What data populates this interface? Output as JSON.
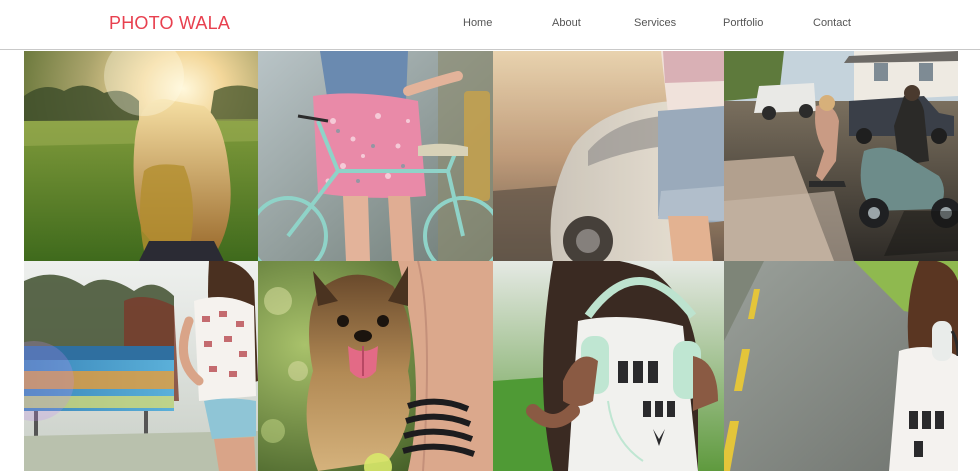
{
  "brand": {
    "name": "PHOTO WALA",
    "color": "#e8404f"
  },
  "nav": {
    "items": [
      {
        "label": "Home"
      },
      {
        "label": "About"
      },
      {
        "label": "Services"
      },
      {
        "label": "Portfolio"
      },
      {
        "label": "Contact"
      }
    ]
  },
  "gallery": {
    "photos": [
      {
        "subject": "girl-in-sunlit-field"
      },
      {
        "subject": "floral-dress-with-bicycle"
      },
      {
        "subject": "denim-shorts-by-car"
      },
      {
        "subject": "skateboard-and-scooter-street"
      },
      {
        "subject": "girl-with-billboard"
      },
      {
        "subject": "yorkshire-terrier-dog"
      },
      {
        "subject": "girl-with-headphones"
      },
      {
        "subject": "girl-on-road"
      }
    ]
  }
}
